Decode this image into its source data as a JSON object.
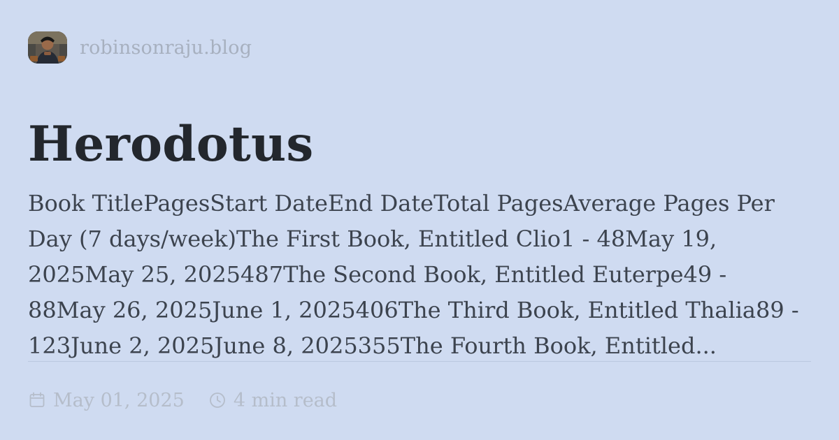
{
  "site": {
    "name": "robinsonraju.blog",
    "avatar_icon": "avatar"
  },
  "post": {
    "title": "Herodotus",
    "excerpt": "Book TitlePagesStart DateEnd DateTotal PagesAverage Pages Per Day (7 days/week)The First Book, Entitled Clio1 - 48May 19, 2025May 25, 2025487The Second Book, Entitled Euterpe49 - 88May 26, 2025June 1, 2025406The Third Book, Entitled Thalia89 - 123June 2, 2025June 8, 2025355The Fourth Book, Entitled...",
    "date": "May 01, 2025",
    "read_time": "4 min read",
    "date_icon": "calendar-icon",
    "read_icon": "clock-icon"
  },
  "colors": {
    "background": "#cfdbf1",
    "title": "#23272d",
    "excerpt": "#3c434e",
    "muted": "#b5bdca"
  }
}
